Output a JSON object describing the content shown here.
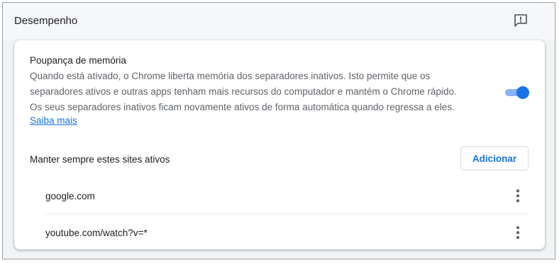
{
  "header": {
    "title": "Desempenho",
    "feedback_icon": "feedback-icon"
  },
  "memory_saver": {
    "title": "Poupança de memória",
    "description_lines": [
      "Quando está ativado, o Chrome liberta memória dos separadores inativos. Isto permite que os",
      "separadores ativos e outras apps tenham mais recursos do computador e mantém o Chrome rápido.",
      "Os seus separadores inativos ficam novamente ativos de forma automática quando regressa a eles."
    ],
    "learn_more": "Saiba mais",
    "toggle_on": true
  },
  "sites": {
    "header": "Manter sempre estes sites ativos",
    "add_label": "Adicionar",
    "items": [
      {
        "label": "google.com"
      },
      {
        "label": "youtube.com/watch?v=*"
      }
    ]
  },
  "colors": {
    "accent": "#1a73e8",
    "toggle_track": "#8ab4f8",
    "page_bg": "#f1f3f4"
  }
}
